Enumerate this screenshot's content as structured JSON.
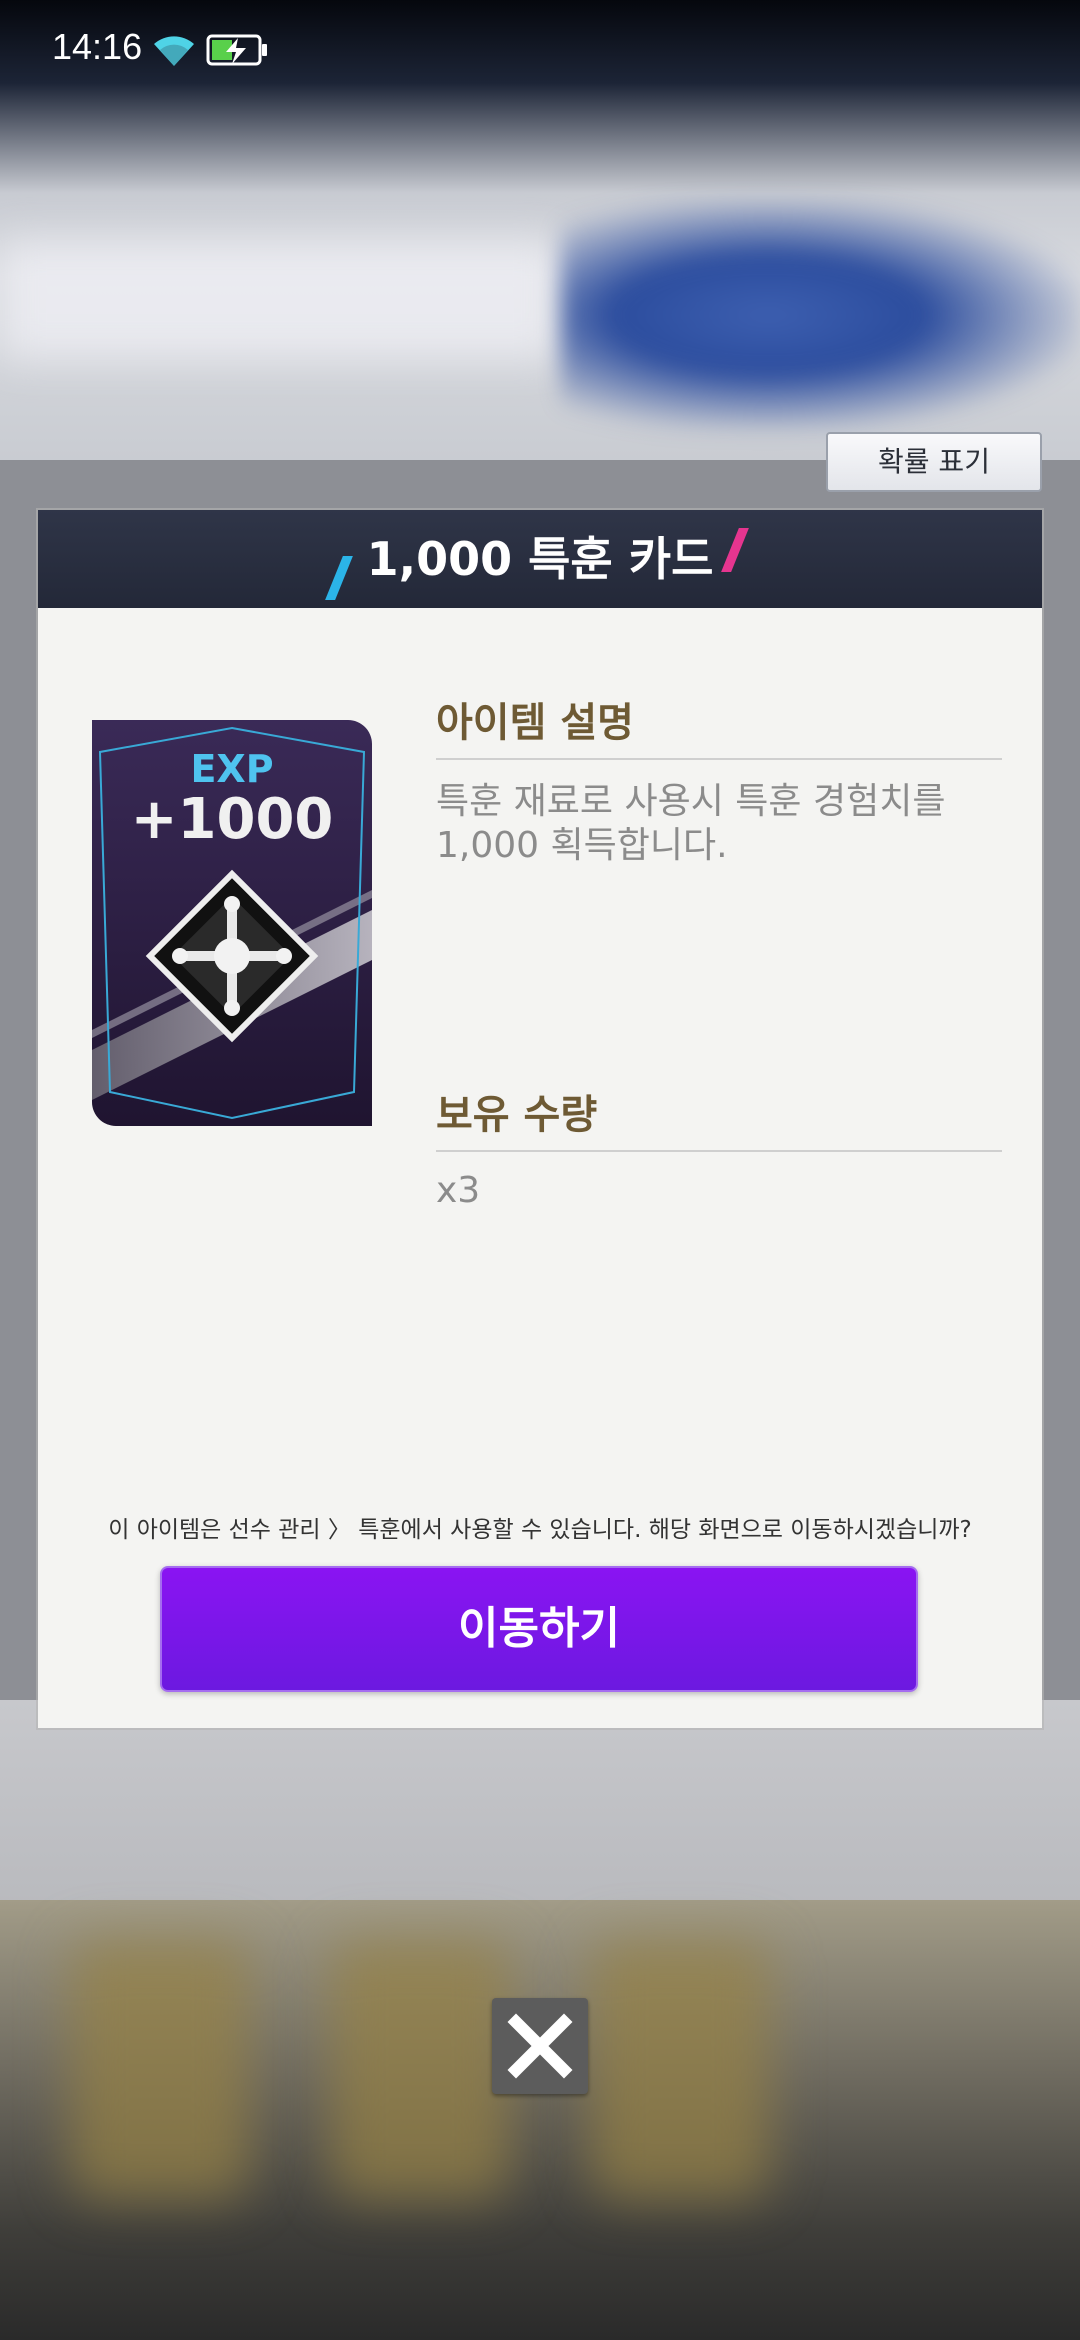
{
  "status_bar": {
    "time": "14:16",
    "wifi_icon": "wifi-icon",
    "battery_icon": "battery-charging-icon"
  },
  "probability_button": {
    "label": "확률 표기"
  },
  "dialog": {
    "title": "1,000 특훈 카드",
    "card": {
      "badge_top": "EXP",
      "badge_value": "+1000",
      "emblem_icon": "diamond-emblem-icon"
    },
    "description": {
      "heading": "아이템 설명",
      "text_line1": "특훈 재료로 사용시 특훈 경험치를",
      "text_line2": "1,000 획득합니다."
    },
    "quantity": {
      "heading": "보유 수량",
      "value": "x3"
    },
    "notice": "이 아이템은 선수 관리 〉 특훈에서 사용할 수 있습니다. 해당 화면으로 이동하시겠습니까?",
    "move_button": {
      "label": "이동하기"
    }
  },
  "close_button": {
    "icon": "close-icon"
  },
  "colors": {
    "accent_purple": "#7a17ea",
    "header_dark": "#2a3042",
    "heading_brown": "#6e5a34",
    "slash_blue": "#2bb4e8",
    "slash_pink": "#e6358f"
  }
}
